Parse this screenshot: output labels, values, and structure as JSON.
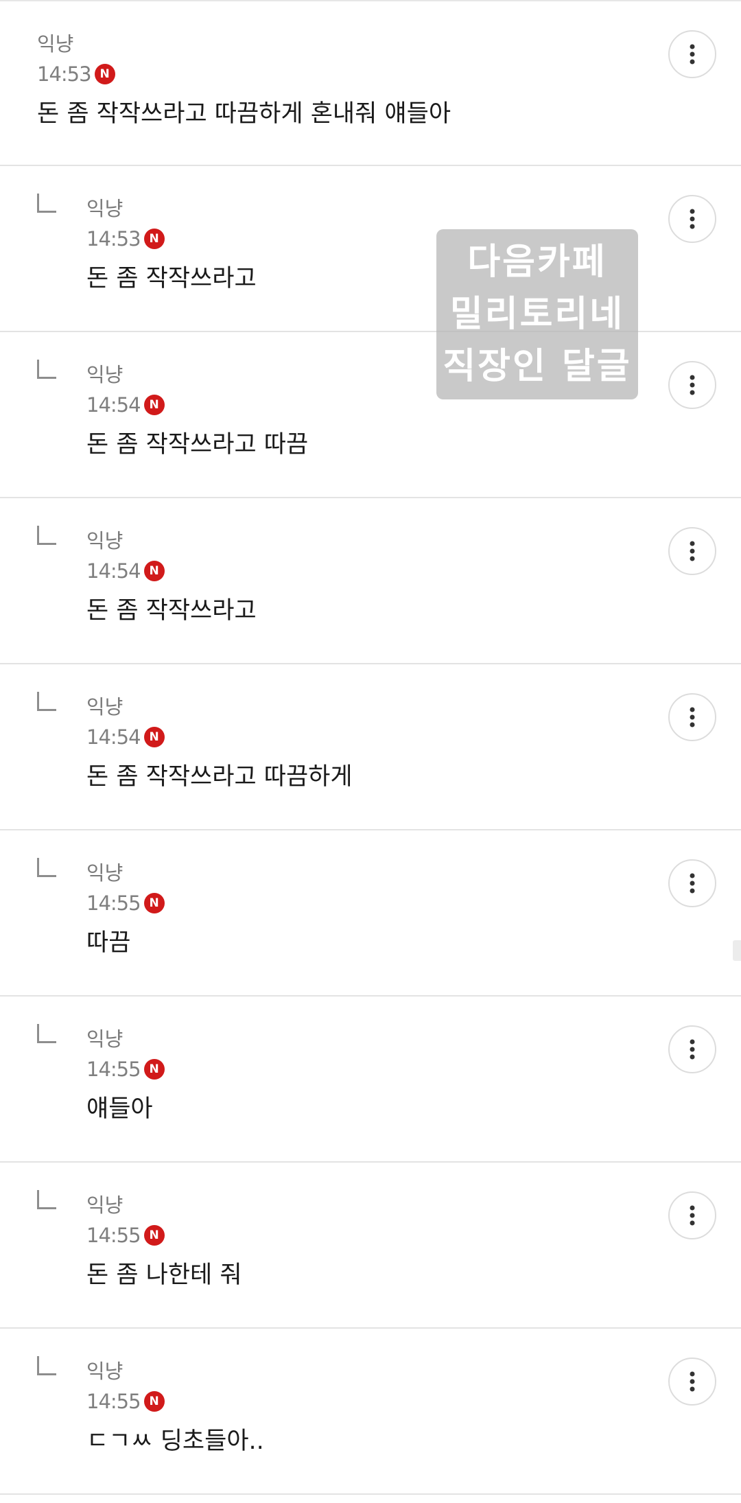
{
  "comments": [
    {
      "author": "익냥",
      "time": "14:53",
      "badge": "N",
      "text": "돈 좀 작작쓰라고 따끔하게 혼내줘 얘들아",
      "reply": false
    },
    {
      "author": "익냥",
      "time": "14:53",
      "badge": "N",
      "text": "돈 좀 작작쓰라고",
      "reply": true
    },
    {
      "author": "익냥",
      "time": "14:54",
      "badge": "N",
      "text": "돈 좀 작작쓰라고 따끔",
      "reply": true
    },
    {
      "author": "익냥",
      "time": "14:54",
      "badge": "N",
      "text": "돈 좀 작작쓰라고",
      "reply": true
    },
    {
      "author": "익냥",
      "time": "14:54",
      "badge": "N",
      "text": "돈 좀 작작쓰라고 따끔하게",
      "reply": true
    },
    {
      "author": "익냥",
      "time": "14:55",
      "badge": "N",
      "text": "따끔",
      "reply": true
    },
    {
      "author": "익냥",
      "time": "14:55",
      "badge": "N",
      "text": "얘들아",
      "reply": true
    },
    {
      "author": "익냥",
      "time": "14:55",
      "badge": "N",
      "text": "돈 좀 나한테 줘",
      "reply": true
    },
    {
      "author": "익냥",
      "time": "14:55",
      "badge": "N",
      "text": "ㄷㄱㅆ 딩초들아..",
      "reply": true
    }
  ],
  "watermark": {
    "lines": [
      "다음카페",
      "밀리토리네",
      "직장인 달글"
    ]
  },
  "icons": {
    "more": "more-vertical-icon",
    "reply": "reply-arrow-icon",
    "new_badge_color": "#d11a1a"
  }
}
